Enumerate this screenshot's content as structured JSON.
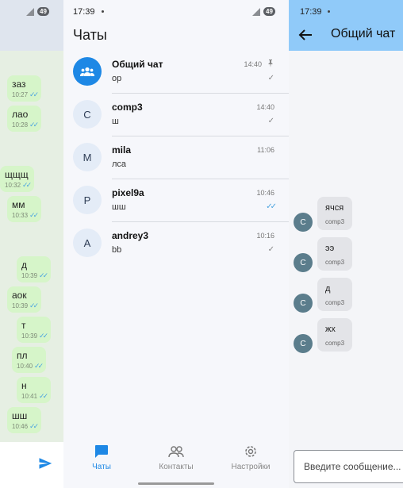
{
  "left_panel": {
    "battery": "49",
    "messages": [
      {
        "text": "заз",
        "time": "10:27"
      },
      {
        "text": "лао",
        "time": "10:28"
      },
      {
        "text": "щщщ",
        "time": "10:32"
      },
      {
        "text": "мм",
        "time": "10:33"
      },
      {
        "text": "д",
        "time": "10:39"
      },
      {
        "text": "аок",
        "time": "10:39"
      },
      {
        "text": "т",
        "time": "10:39"
      },
      {
        "text": "пл",
        "time": "10:40"
      },
      {
        "text": "н",
        "time": "10:41"
      },
      {
        "text": "шш",
        "time": "10:46"
      }
    ]
  },
  "middle_panel": {
    "status_time": "17:39",
    "battery": "49",
    "title": "Чаты",
    "chats": [
      {
        "avatar": "",
        "name": "Общий чат",
        "last": "ор",
        "time": "14:40"
      },
      {
        "avatar": "C",
        "name": "comp3",
        "last": "ш",
        "time": "14:40"
      },
      {
        "avatar": "M",
        "name": "mila",
        "last": "лса",
        "time": "11:06"
      },
      {
        "avatar": "P",
        "name": "pixel9a",
        "last": "шш",
        "time": "10:46"
      },
      {
        "avatar": "A",
        "name": "andrey3",
        "last": "bb",
        "time": "10:16"
      }
    ],
    "nav": {
      "chats": "Чаты",
      "contacts": "Контакты",
      "settings": "Настройки"
    }
  },
  "right_panel": {
    "status_time": "17:39",
    "title": "Общий чат",
    "messages": [
      {
        "avatar": "C",
        "text": "ячся",
        "sender": "comp3"
      },
      {
        "avatar": "C",
        "text": "ээ",
        "sender": "comp3"
      },
      {
        "avatar": "C",
        "text": "д",
        "sender": "comp3"
      },
      {
        "avatar": "C",
        "text": "жх",
        "sender": "comp3"
      }
    ],
    "input_placeholder": "Введите сообщение..."
  },
  "colors": {
    "accent": "#1e88e5",
    "header_blue": "#90caf9",
    "outgoing_bubble": "#d6f5c9",
    "incoming_bubble": "#e3e4e8"
  }
}
